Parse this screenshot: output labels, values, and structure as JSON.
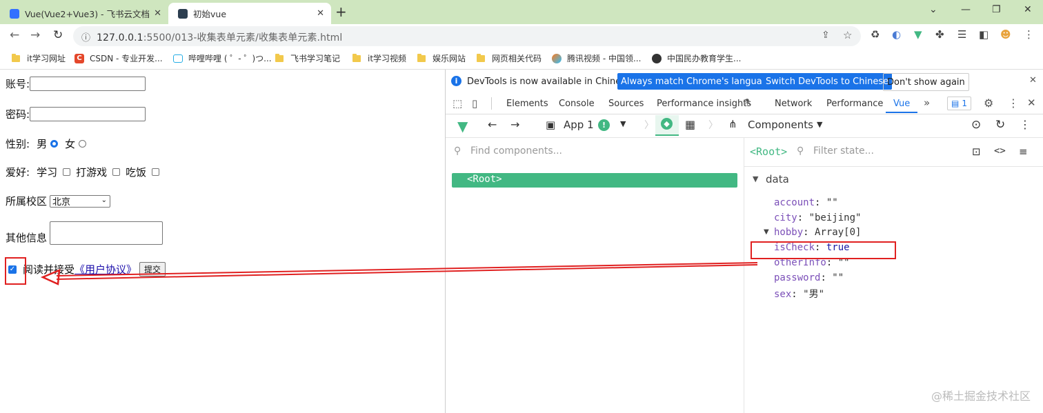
{
  "browser": {
    "tabs": [
      {
        "title": "Vue(Vue2+Vue3) - 飞书云文档",
        "active": false
      },
      {
        "title": "初始vue",
        "active": true
      }
    ],
    "url_host": "127.0.0.1",
    "url_path": ":5500/013-收集表单元素/收集表单元素.html",
    "bookmarks": [
      {
        "label": "it学习网址",
        "icon": "folder-icon"
      },
      {
        "label": "CSDN - 专业开发...",
        "icon": "csdn-icon"
      },
      {
        "label": "哔哩哔哩 ( ゜- ゜)つ...",
        "icon": "bilibili-icon"
      },
      {
        "label": "飞书学习笔记",
        "icon": "folder-icon"
      },
      {
        "label": "it学习视频",
        "icon": "folder-icon"
      },
      {
        "label": "娱乐网站",
        "icon": "folder-icon"
      },
      {
        "label": "网页相关代码",
        "icon": "folder-icon"
      },
      {
        "label": "腾讯视频 - 中国领...",
        "icon": "tencent-video-icon"
      },
      {
        "label": "中国民办教育学生...",
        "icon": "globe-icon"
      }
    ]
  },
  "form": {
    "account_label": "账号:",
    "account_value": "",
    "password_label": "密码:",
    "password_value": "",
    "gender_label": "性别:",
    "gender_male": "男",
    "gender_female": "女",
    "hobby_label": "爱好:",
    "hobbies": [
      "学习",
      "打游戏",
      "吃饭"
    ],
    "campus_label": "所属校区",
    "campus_selected": "北京",
    "other_label": "其他信息",
    "agree_text": "阅读并接受",
    "agreement_link": "《用户协议》",
    "submit_label": "提交"
  },
  "devtools": {
    "info_message": "DevTools is now available in Chinese!",
    "btn_match": "Always match Chrome's language",
    "btn_switch": "Switch DevTools to Chinese",
    "btn_dont_show": "Don't show again",
    "tabs": [
      "Elements",
      "Console",
      "Sources",
      "Performance insights",
      "Network",
      "Performance",
      "Vue"
    ],
    "active_tab": "Vue",
    "issues_count": "1",
    "app_label": "App 1",
    "components_label": "Components",
    "find_placeholder": "Find components...",
    "filter_placeholder": "Filter state...",
    "root_node": "<Root>",
    "root_tag": "<Root>",
    "data_section": "data",
    "state": [
      {
        "key": "account",
        "value": "\"\""
      },
      {
        "key": "city",
        "value": "\"beijing\""
      },
      {
        "key": "hobby",
        "value": "Array[0]"
      },
      {
        "key": "isCheck",
        "value": "true"
      },
      {
        "key": "otherInfo",
        "value": "\"\""
      },
      {
        "key": "password",
        "value": "\"\""
      },
      {
        "key": "sex",
        "value": "\"男\""
      }
    ]
  },
  "watermark": "@稀土掘金技术社区",
  "colors": {
    "tabstrip": "#cfe6bf",
    "vue_green": "#42b883",
    "chrome_blue": "#1a73e8",
    "annotation_red": "#e02020"
  }
}
